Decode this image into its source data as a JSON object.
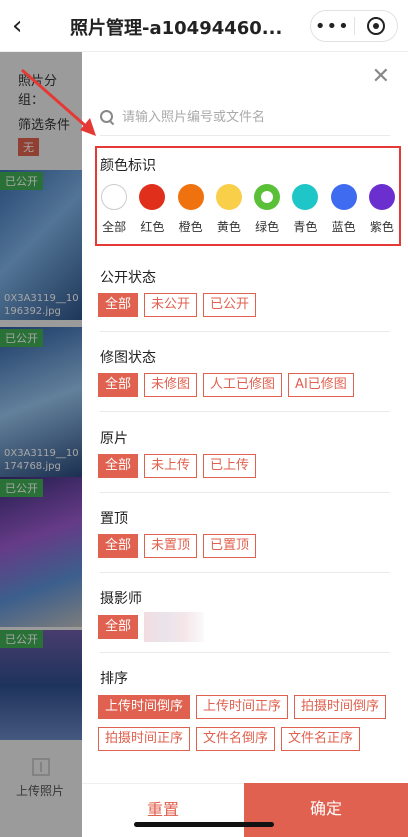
{
  "header": {
    "title": "照片管理-a10494460...",
    "back_icon": "chevron-left-icon",
    "more_icon": "more-dots-icon",
    "close_icon": "target-circle-icon"
  },
  "background": {
    "group_label": "照片分组：",
    "filter_label": "筛选条件",
    "filter_none": "无",
    "photos": [
      {
        "badge": "已公开",
        "name": "0X3A3119__10196392.jpg"
      },
      {
        "badge": "已公开",
        "name": "0X3A3119__10174768.jpg"
      },
      {
        "badge": "已公开",
        "name": ""
      },
      {
        "badge": "已公开",
        "name": ""
      }
    ],
    "upload_label": "上传照片"
  },
  "drawer": {
    "search_placeholder": "请输入照片编号或文件名",
    "color_section": {
      "title": "颜色标识",
      "items": [
        {
          "label": "全部",
          "color": "#ffffff"
        },
        {
          "label": "红色",
          "color": "#e02f1b"
        },
        {
          "label": "橙色",
          "color": "#f0720f"
        },
        {
          "label": "黄色",
          "color": "#f9cf4a"
        },
        {
          "label": "绿色",
          "color": "#59c038"
        },
        {
          "label": "青色",
          "color": "#1fc6c8"
        },
        {
          "label": "蓝色",
          "color": "#3f6bf0"
        },
        {
          "label": "紫色",
          "color": "#6b2fcf"
        }
      ]
    },
    "public_section": {
      "title": "公开状态",
      "options": [
        "全部",
        "未公开",
        "已公开"
      ]
    },
    "retouch_section": {
      "title": "修图状态",
      "options": [
        "全部",
        "未修图",
        "人工已修图",
        "AI已修图"
      ]
    },
    "original_section": {
      "title": "原片",
      "options": [
        "全部",
        "未上传",
        "已上传"
      ]
    },
    "pin_section": {
      "title": "置顶",
      "options": [
        "全部",
        "未置顶",
        "已置顶"
      ]
    },
    "photographer_section": {
      "title": "摄影师",
      "options": [
        "全部"
      ]
    },
    "sort_section": {
      "title": "排序",
      "options": [
        "上传时间倒序",
        "上传时间正序",
        "拍摄时间倒序",
        "拍摄时间正序",
        "文件名倒序",
        "文件名正序"
      ]
    },
    "reset_label": "重置",
    "confirm_label": "确定"
  },
  "colors": {
    "accent": "#e0614f",
    "highlight_box": "#e53935"
  }
}
